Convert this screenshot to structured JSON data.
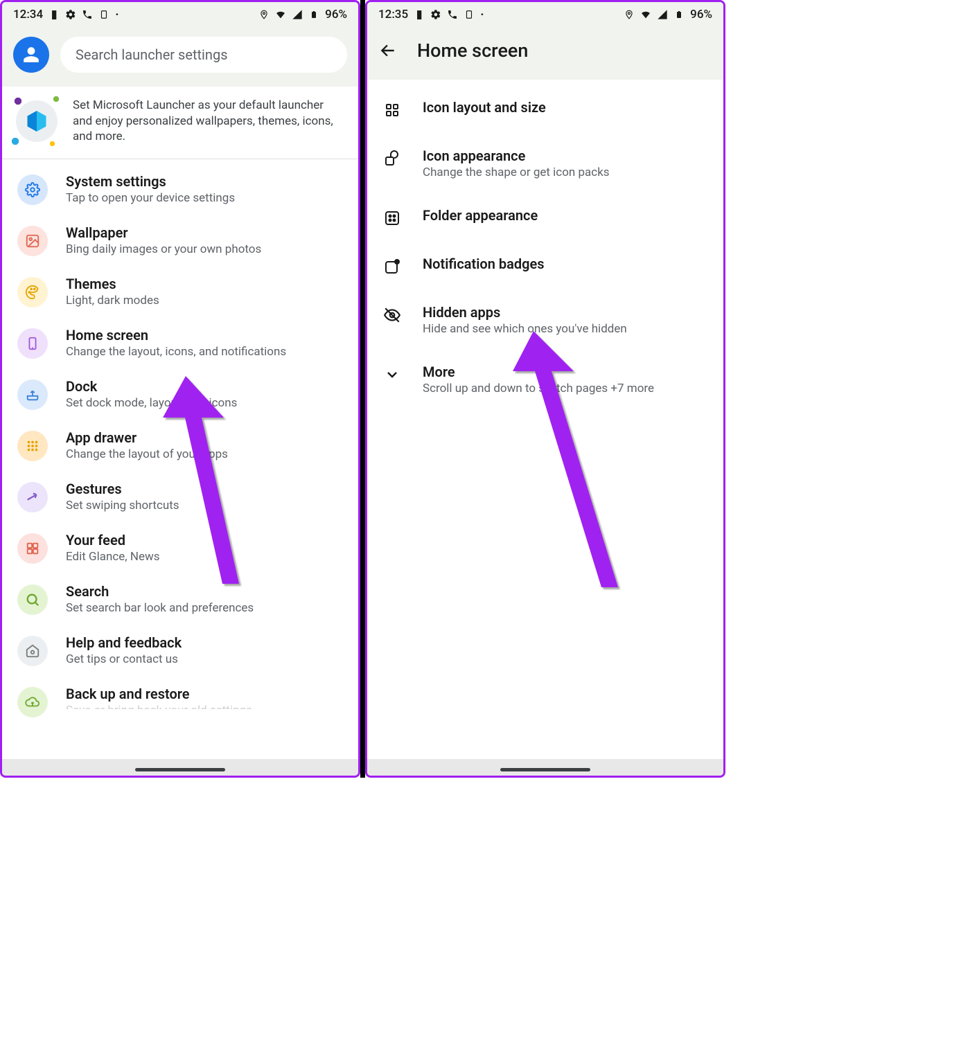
{
  "left": {
    "status": {
      "time": "12:34",
      "battery": "96%"
    },
    "search_placeholder": "Search launcher settings",
    "promo_text": "Set Microsoft Launcher as your default launcher and enjoy personalized wallpapers, themes, icons, and more.",
    "items": [
      {
        "title": "System settings",
        "sub": "Tap to open your device settings"
      },
      {
        "title": "Wallpaper",
        "sub": "Bing daily images or your own photos"
      },
      {
        "title": "Themes",
        "sub": "Light, dark modes"
      },
      {
        "title": "Home screen",
        "sub": "Change the layout, icons, and notifications"
      },
      {
        "title": "Dock",
        "sub": "Set dock mode, layout, and icons"
      },
      {
        "title": "App drawer",
        "sub": "Change the layout of your apps"
      },
      {
        "title": "Gestures",
        "sub": "Set swiping shortcuts"
      },
      {
        "title": "Your feed",
        "sub": "Edit Glance, News"
      },
      {
        "title": "Search",
        "sub": "Set search bar look and preferences"
      },
      {
        "title": "Help and feedback",
        "sub": "Get tips or contact us"
      },
      {
        "title": "Back up and restore",
        "sub": "Save or bring back your old settings"
      }
    ]
  },
  "right": {
    "status": {
      "time": "12:35",
      "battery": "96%"
    },
    "page_title": "Home screen",
    "items": [
      {
        "title": "Icon layout and size",
        "sub": ""
      },
      {
        "title": "Icon appearance",
        "sub": "Change the shape or get icon packs"
      },
      {
        "title": "Folder appearance",
        "sub": ""
      },
      {
        "title": "Notification badges",
        "sub": ""
      },
      {
        "title": "Hidden apps",
        "sub": "Hide and see which ones you've hidden"
      },
      {
        "title": "More",
        "sub": "Scroll up and down to switch pages +7 more"
      }
    ]
  }
}
